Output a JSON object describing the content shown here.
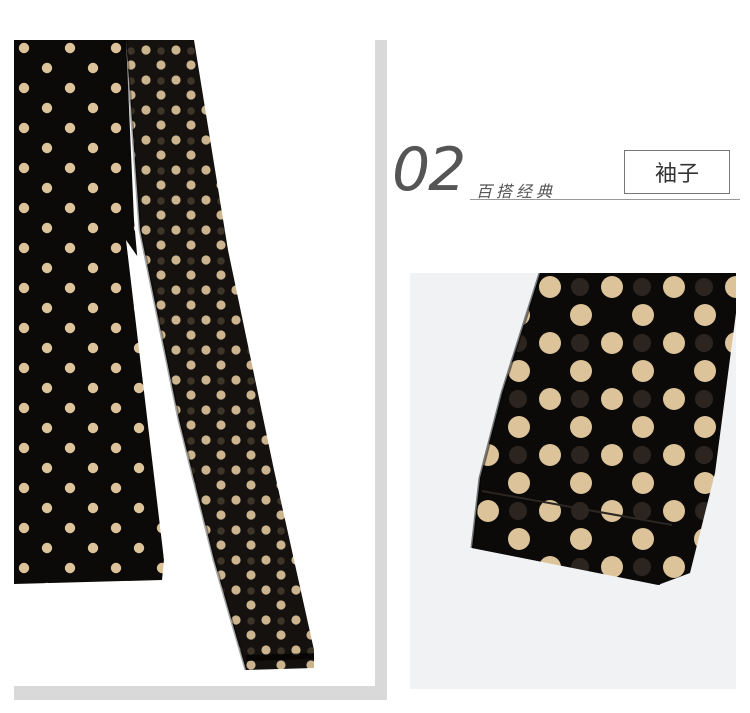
{
  "section": {
    "number": "02",
    "subtitle": "百搭经典",
    "tag": "袖子"
  },
  "images": {
    "left": "polka-dot-sleeve-full-photo",
    "right": "polka-dot-sleeve-cuff-closeup"
  },
  "colors": {
    "fabric": "#0b0a09",
    "dot": "#dcc399",
    "background": "#ffffff",
    "frame_shadow": "#d9d9d9",
    "closeup_background": "#f0f2f4",
    "title_text": "#555555"
  }
}
